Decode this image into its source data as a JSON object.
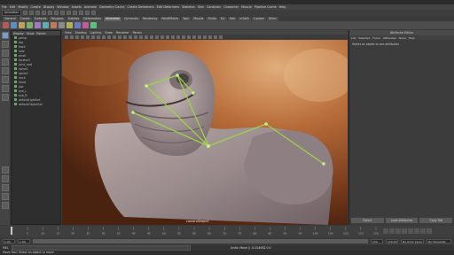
{
  "window": {
    "title": "Autodesk Maya"
  },
  "menus": [
    "File",
    "Edit",
    "Modify",
    "Create",
    "Display",
    "Window",
    "Assets",
    "Animate",
    "Geometry Cache",
    "Create Deformers",
    "Edit Deformers",
    "Skeleton",
    "Skin",
    "Constrain",
    "Character",
    "Muscle",
    "Pipeline Cache",
    "Help"
  ],
  "status": {
    "mode": "Animation"
  },
  "shelf_tabs": [
    {
      "label": "General",
      "active": false
    },
    {
      "label": "Curves",
      "active": false
    },
    {
      "label": "Surfaces",
      "active": false
    },
    {
      "label": "Polygons",
      "active": false
    },
    {
      "label": "Subdivs",
      "active": false
    },
    {
      "label": "Deformation",
      "active": false
    },
    {
      "label": "Animation",
      "active": true
    },
    {
      "label": "Dynamics",
      "active": false
    },
    {
      "label": "Rendering",
      "active": false
    },
    {
      "label": "PaintEffects",
      "active": false
    },
    {
      "label": "Toon",
      "active": false
    },
    {
      "label": "Muscle",
      "active": false
    },
    {
      "label": "Fluids",
      "active": false
    },
    {
      "label": "Fur",
      "active": false
    },
    {
      "label": "Hair",
      "active": false
    },
    {
      "label": "nCloth",
      "active": false
    },
    {
      "label": "Custom",
      "active": false
    },
    {
      "label": "XGen",
      "active": false
    }
  ],
  "shelf_colors": [
    "#b85a5a",
    "#5a8fc0",
    "#c0a05a",
    "#7ab06a",
    "#a07ac0",
    "#5ab0b0",
    "#c07a5a",
    "#8a8a8a",
    "#b0b05a",
    "#6a7ac0",
    "#c05a9a",
    "#5ac07a"
  ],
  "outliner": {
    "menus": [
      "Display",
      "Show",
      "Panels"
    ],
    "items": [
      "persp",
      "top",
      "front",
      "side",
      "pivot",
      "locator1",
      "joint_root",
      "spine1",
      "spine2",
      "neck",
      "head",
      "jaw",
      "eye_L",
      "eye_R",
      "defaultLightSet",
      "defaultObjectSet"
    ]
  },
  "viewport": {
    "menus": [
      "View",
      "Shading",
      "Lighting",
      "Show",
      "Renderer",
      "Panels"
    ],
    "camera_label": "cameraShape1"
  },
  "attribute_editor": {
    "title": "Attribute Editor",
    "tabs": [
      "List",
      "Selected",
      "Focus",
      "Attributes",
      "Show",
      "Help"
    ],
    "message": "Select an object to see attributes",
    "buttons": [
      "Select",
      "Load Attributes",
      "Copy Tab"
    ]
  },
  "timeline": {
    "labels": [
      "1",
      "5",
      "10",
      "15",
      "20",
      "25",
      "30",
      "35",
      "40",
      "45",
      "50",
      "55",
      "60",
      "65",
      "70",
      "75",
      "80",
      "85",
      "90",
      "95",
      "100",
      "105",
      "110",
      "115",
      "120"
    ]
  },
  "range": {
    "start": "1.00",
    "start2": "1.00",
    "end": "120",
    "end2": "120.00",
    "anim_layer": "No Anim Layer",
    "char_set": "No Character Set"
  },
  "command": {
    "label": "MEL",
    "result": "Undo: Move // -0.024062 0.0"
  },
  "help_line": "Move Tool: Select an object to move."
}
